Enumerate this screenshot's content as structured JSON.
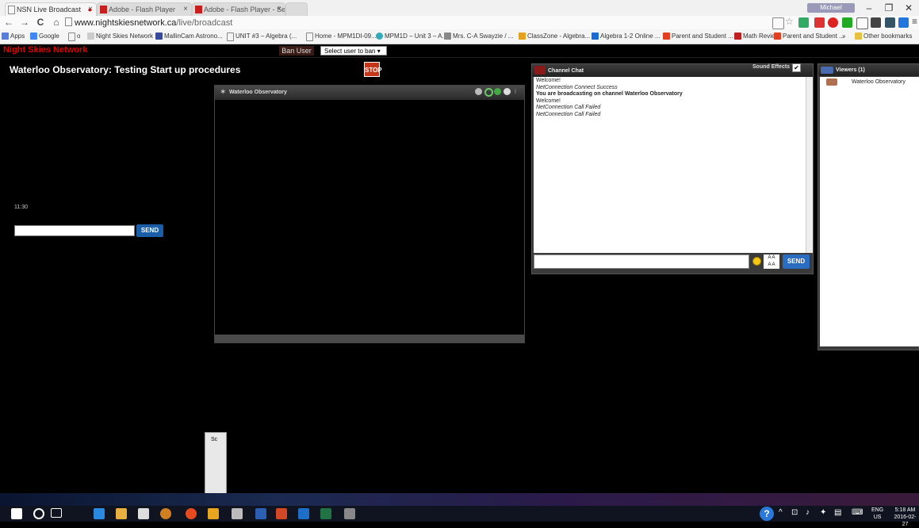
{
  "browser": {
    "tabs": [
      {
        "title": "NSN Live Broadcast",
        "active": true
      },
      {
        "title": "Adobe - Flash Player",
        "active": false
      },
      {
        "title": "Adobe - Flash Player - Sett",
        "active": false
      }
    ],
    "profile_name": "Michael Schwartz",
    "address": {
      "host": "www.nightskiesnetwork.ca",
      "path": "/live/broadcast"
    },
    "bookmarks": [
      "Apps",
      "Google",
      "o",
      "Night Skies Network",
      "MallinCam Astrono...",
      "UNIT #3 – Algebra (...",
      "Home - MPM1DI-09...",
      "MPM1D – Unit 3 – A...",
      "Mrs. C-A Swayzie / ...",
      "ClassZone - Algebra...",
      "Algebra 1-2 Online ...",
      "Parent and Student ...",
      "Math Review",
      "Parent and Student ...",
      "»",
      "Other bookmarks"
    ]
  },
  "site": {
    "name": "Night Skies Network",
    "ban_label": "Ban User",
    "ban_select": "Select user to ban",
    "page_title": "Waterloo Observatory: Testing Start up procedures",
    "stop_label": "STOP",
    "timer": "11:30",
    "left_send": "SEND"
  },
  "video": {
    "title": "Waterloo Observatory"
  },
  "chat": {
    "title": "Channel Chat",
    "sound_effects": "Sound Effects",
    "messages": [
      {
        "text": "Welcome!",
        "style": ""
      },
      {
        "text": "NetConnection Connect Success",
        "style": "it"
      },
      {
        "text": "You are broadcasting on channel Waterloo Observatory",
        "style": "b"
      },
      {
        "text": "Welcome!",
        "style": ""
      },
      {
        "text": "NetConnection Call Failed",
        "style": "it"
      },
      {
        "text": "NetConnection Call Failed",
        "style": "it"
      }
    ],
    "send": "SEND"
  },
  "viewers": {
    "title": "Viewers (1)",
    "list": [
      "Waterloo Observatory"
    ]
  },
  "thumbnail": {
    "title": "Sc"
  },
  "taskbar": {
    "lang": "ENG",
    "region": "US",
    "time": "5:18 AM",
    "date": "2016-02-27"
  }
}
